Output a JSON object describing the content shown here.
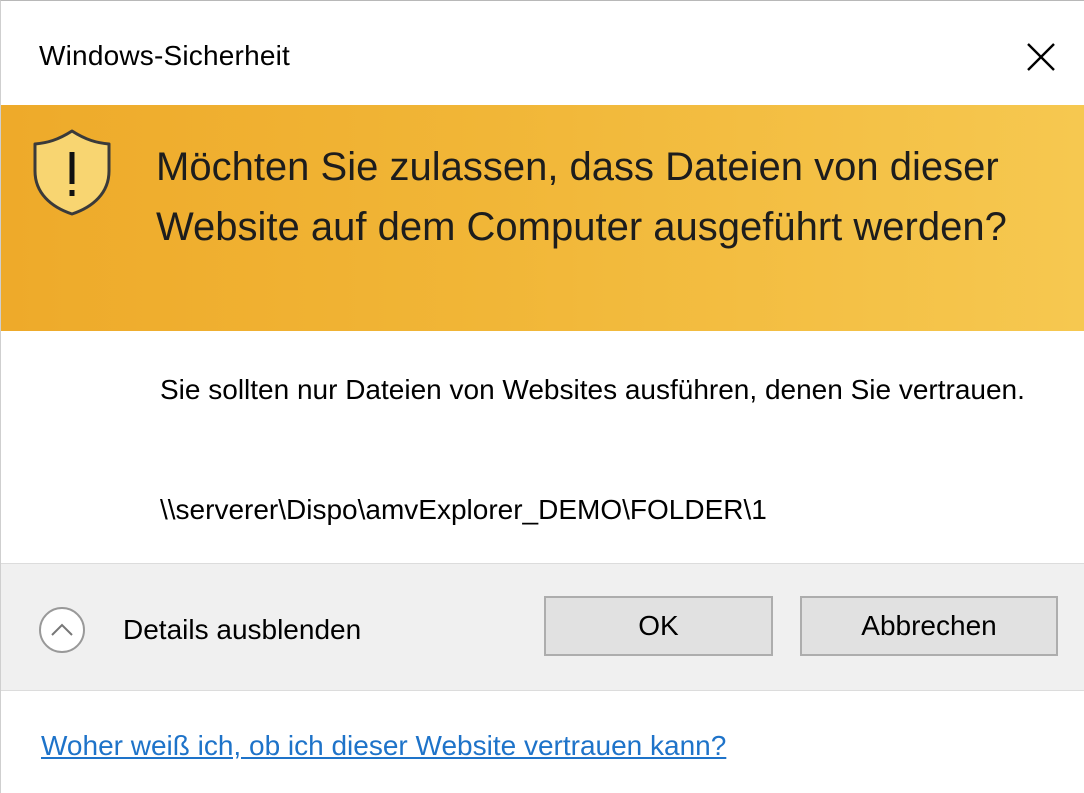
{
  "window": {
    "title": "Windows-Sicherheit",
    "close_icon": "close-icon"
  },
  "banner": {
    "icon": "shield-warning-icon",
    "headline": "Möchten Sie zulassen, dass Dateien von dieser Website auf dem Computer ausgeführt werden?",
    "colors": {
      "start": "#eeaa2a",
      "end": "#f6c850"
    }
  },
  "content": {
    "info": "Sie sollten nur Dateien von Websites ausführen, denen Sie vertrauen.",
    "path": "\\\\serverer\\Dispo\\amvExplorer_DEMO\\FOLDER\\1"
  },
  "footer": {
    "details_label": "Details ausblenden",
    "details_icon": "chevron-up-icon",
    "ok_label": "OK",
    "cancel_label": "Abbrechen"
  },
  "help": {
    "link_text": "Woher weiß ich, ob ich dieser Website vertrauen kann?",
    "link_color": "#1e73c9"
  }
}
